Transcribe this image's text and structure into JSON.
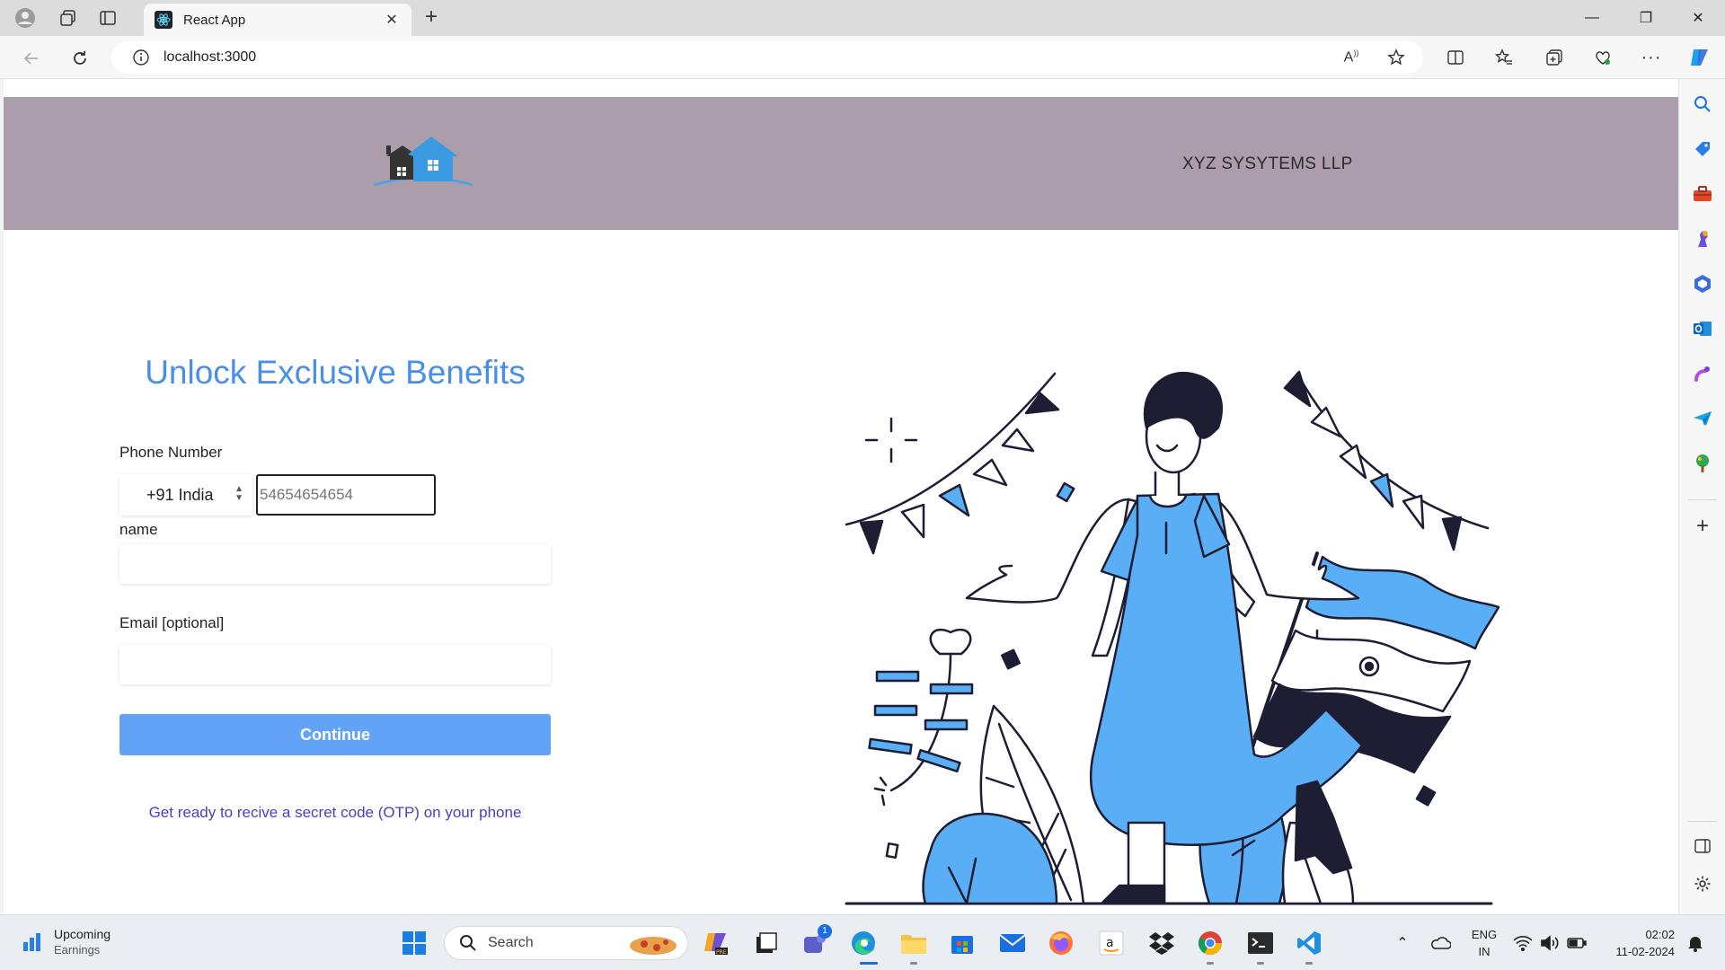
{
  "browser": {
    "tab_title": "React App",
    "url": "localhost:3000"
  },
  "header": {
    "company_name": "XYZ SYSYTEMS LLP"
  },
  "form": {
    "headline": "Unlock Exclusive Benefits",
    "phone_label": "Phone Number",
    "country_code": "+91 India",
    "phone_placeholder": "54654654654",
    "name_label": "name",
    "email_label": "Email [optional]",
    "continue_label": "Continue",
    "otp_note": "Get ready to recive a secret code (OTP) on your phone"
  },
  "taskbar": {
    "weather_title": "Upcoming",
    "weather_sub": "Earnings",
    "search_label": "Search",
    "teams_badge": "1",
    "lang_top": "ENG",
    "lang_bottom": "IN",
    "time": "02:02",
    "date": "11-02-2024"
  },
  "colors": {
    "header_bg": "#ab9eaa",
    "headline": "#4a8fe7",
    "button": "#63a3f7",
    "illustration_blue": "#5aaef5",
    "link": "#4a3fc4"
  }
}
